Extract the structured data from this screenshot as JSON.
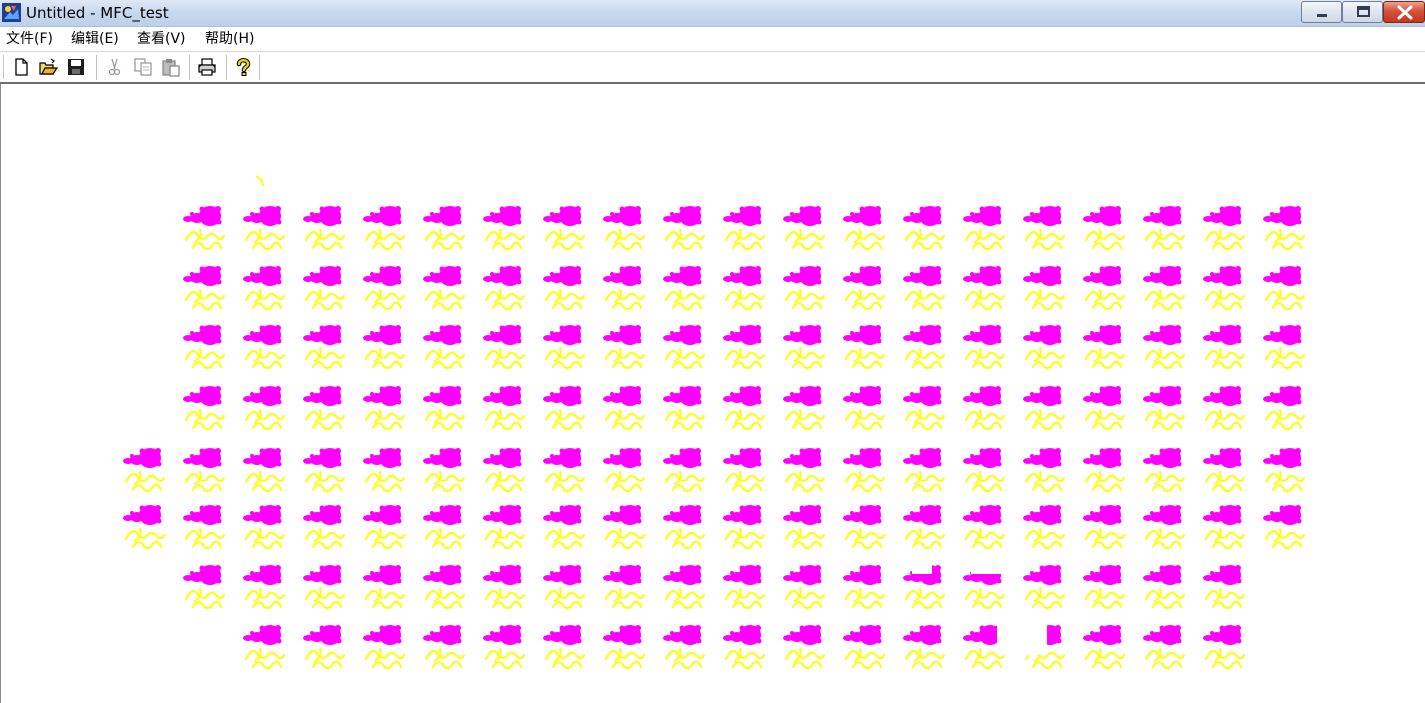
{
  "window": {
    "title": "Untitled - MFC_test",
    "title_bar_color": "#c9d9ee",
    "controls": [
      "minimize",
      "maximize",
      "close"
    ]
  },
  "menu": {
    "items": [
      {
        "label": "文件(F)"
      },
      {
        "label": "编辑(E)"
      },
      {
        "label": "查看(V)"
      },
      {
        "label": "帮助(H)"
      }
    ]
  },
  "toolbar": {
    "buttons": [
      {
        "name": "new",
        "icon": "new-document-icon",
        "enabled": true
      },
      {
        "name": "open",
        "icon": "open-folder-icon",
        "enabled": true
      },
      {
        "name": "save",
        "icon": "save-disk-icon",
        "enabled": true
      },
      {
        "name": "cut",
        "icon": "cut-scissors-icon",
        "enabled": false
      },
      {
        "name": "copy",
        "icon": "copy-icon",
        "enabled": false
      },
      {
        "name": "paste",
        "icon": "paste-icon",
        "enabled": false
      },
      {
        "name": "print",
        "icon": "print-icon",
        "enabled": true
      },
      {
        "name": "about",
        "icon": "help-question-icon",
        "enabled": true
      }
    ]
  },
  "canvas": {
    "sprite": "magenta-blob-with-yellow-tendrils",
    "sprite_colors": {
      "head": "#ff00ff",
      "tendrils": "#ffff00"
    },
    "rows": [
      {
        "count": 19
      },
      {
        "count": 19
      },
      {
        "count": 19
      },
      {
        "count": 19
      },
      {
        "count": 20
      },
      {
        "count": 20
      },
      {
        "count": 18
      },
      {
        "count": 17
      }
    ]
  }
}
